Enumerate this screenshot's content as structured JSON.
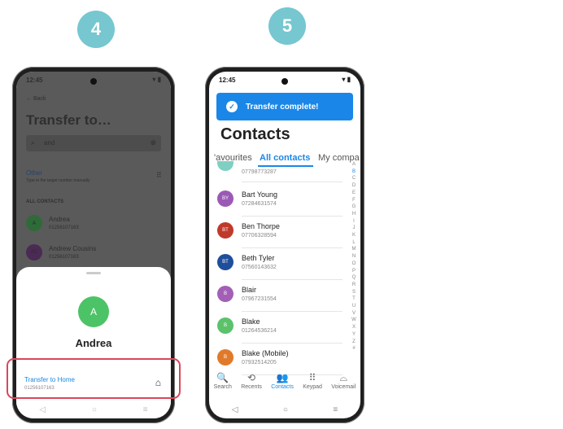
{
  "steps": {
    "left": "4",
    "right": "5"
  },
  "phone4": {
    "time": "12:45",
    "status_icons": "▾ ▮",
    "back_label": "Back",
    "title": "Transfer to…",
    "search_value": "and",
    "other_label": "Other",
    "other_sub": "Type in the target number manually",
    "all_contacts_label": "ALL CONTACTS",
    "contacts": [
      {
        "initial": "A",
        "name": "Andrea",
        "phone": "01256107163"
      },
      {
        "initial": "AC",
        "name": "Andrew Cousins",
        "phone": "01256107163"
      }
    ],
    "sheet": {
      "initial": "A",
      "name": "Andrea",
      "action_label": "Transfer to Home",
      "action_phone": "01256107163",
      "action_icon": "home-icon"
    },
    "nav": {
      "back": "◁",
      "home": "○",
      "recents": "≡"
    }
  },
  "phone5": {
    "time": "12:45",
    "status_icons": "▾ ▮",
    "banner_text": "Transfer complete!",
    "title": "Contacts",
    "tabs": [
      "'avourites",
      "All contacts",
      "My compa"
    ],
    "top_partial_phone": "07798773287",
    "contacts": [
      {
        "initial": "BY",
        "name": "Bart Young",
        "phone": "07284631574",
        "color": "#9b59b6"
      },
      {
        "initial": "BT",
        "name": "Ben Thorpe",
        "phone": "07706328594",
        "color": "#c0392b"
      },
      {
        "initial": "BT",
        "name": "Beth Tyler",
        "phone": "07560143632",
        "color": "#1f4e9a"
      },
      {
        "initial": "B",
        "name": "Blair",
        "phone": "07967231554",
        "color": "#a35fb5"
      },
      {
        "initial": "B",
        "name": "Blake",
        "phone": "01264536214",
        "color": "#5bc26b"
      },
      {
        "initial": "B",
        "name": "Blake (Mobile)",
        "phone": "07932514205",
        "color": "#e07a2a"
      }
    ],
    "alphabet": [
      "A",
      "B",
      "C",
      "D",
      "E",
      "F",
      "G",
      "H",
      "I",
      "J",
      "K",
      "L",
      "M",
      "N",
      "O",
      "P",
      "Q",
      "R",
      "S",
      "T",
      "U",
      "V",
      "W",
      "X",
      "Y",
      "Z",
      "#"
    ],
    "bottom_nav": [
      {
        "label": "Search",
        "icon": "🔍"
      },
      {
        "label": "Recents",
        "icon": "⟲"
      },
      {
        "label": "Contacts",
        "icon": "👥"
      },
      {
        "label": "Keypad",
        "icon": "⠿"
      },
      {
        "label": "Voicemail",
        "icon": "⌓"
      }
    ],
    "nav": {
      "back": "◁",
      "home": "○",
      "recents": "≡"
    },
    "accent": "#1a87e8"
  }
}
